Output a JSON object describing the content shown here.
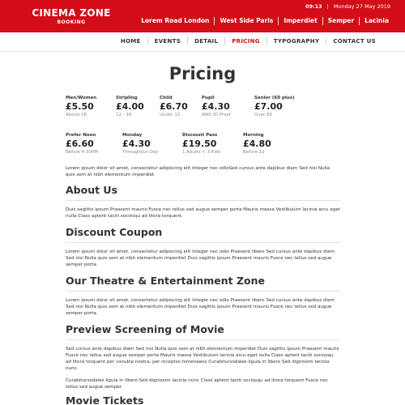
{
  "brand": {
    "name": "CINEMA ZONE",
    "sub": "BOOKING"
  },
  "topbar": {
    "time": "09:13",
    "date": "Monday 27 May 2019",
    "locations": [
      "Lorem Road London",
      "West Side Paris",
      "Imperdiet",
      "Semper",
      "Lacinia"
    ]
  },
  "nav": {
    "items": [
      "HOME",
      "EVENTS",
      "DETAIL",
      "PRICING",
      "TYPOGRAPHY",
      "CONTACT US"
    ],
    "active": "PRICING"
  },
  "colors": {
    "brand": "#d30d17",
    "text": "#333333",
    "muted": "#888888"
  },
  "page": {
    "title": "Pricing"
  },
  "prices": [
    {
      "label": "Men/Women",
      "value": "£5.50",
      "note": "Above 18"
    },
    {
      "label": "Stripling",
      "value": "£4.00",
      "note": "12 - 16"
    },
    {
      "label": "Child",
      "value": "£6.70",
      "note": "Under 12"
    },
    {
      "label": "Pupil",
      "value": "£4.30",
      "note": "With ID Proof"
    },
    {
      "label": "Senior (60 plus)",
      "value": "£7.00",
      "note": "Over 65"
    },
    {
      "label": "Prefer Noon",
      "value": "£6.60",
      "note": "Before 4.30PM"
    },
    {
      "label": "Monday",
      "value": "£4.30",
      "note": "Throughout Day"
    },
    {
      "label": "Discount Pass",
      "value": "£19.50",
      "note": "1 Adults < 3 Kids"
    },
    {
      "label": "Morning",
      "value": "£4.80",
      "note": "Before 12"
    }
  ],
  "intro": "Lorem ipsum dolor sit amet, consectetur adipiscing elit Integer nec odioSed cursus ante dapibus diam Sed nisi Nulla quis sem at nibh elementum imperdiet.",
  "sections": [
    {
      "title": "About Us",
      "text": "Duis sagittis ipsum Praesent mauris Fusce nec tellus sed augue semper porta Mauris massa Vestibulum lacinia arcu eget nulla Class aptent taciti sociosqu ad litora torquent."
    },
    {
      "title": "Discount Coupon",
      "text": "Lorem ipsum dolor sit amet, consectetur adipiscing elit Integer nec odio Praesent libero Sed cursus ante dapibus diam Sed nisi Nulla quis sem at nibh elementum imperdiet Duis sagittis ipsum Praesent mauris Fusce nec tellus sed augue semper porta."
    },
    {
      "title": "Our Theatre & Entertainment Zone",
      "text": "Lorem ipsum dolor sit amet, consectetur adipiscing elit Integer nec odio Praesent libero Sed cursus ante dapibus diam Sed nisi Nulla quis sem at nibh elementum imperdiet Duis sagittis ipsum Praesent mauris Fusce nec tellus sed augue semper porta."
    },
    {
      "title": "Preview Screening of Movie",
      "text": "Sed cursus ante dapibus diam Sed nisi Nulla quis sem at nibh elementum imperdiet Duis sagittis ipsum Praesent mauris Fusce nec tellus sed augue semper porta Mauris massa Vestibulum lacinia arcu eget nulla Class aptent taciti sociosqu ad litora torquent per conubia nostra, per inceptos himenaeos Curabitursodales ligula in libero Sed dignissim lacinia nunc.",
      "text2": "Curabitursodales ligula in libero Sed dignissim lacinia nunc Class aptent taciti sociosqu ad litora torquent Fusce nec tellus sed augue semper"
    },
    {
      "title": "Movie Tickets"
    }
  ]
}
